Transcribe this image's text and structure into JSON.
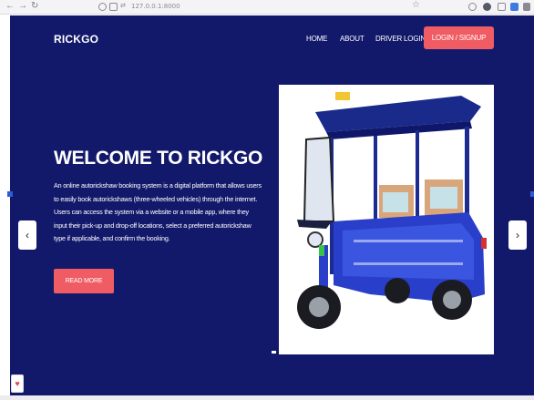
{
  "browser": {
    "url": "127.0.0.1:8000",
    "back_icon": "arrow-left-icon",
    "forward_icon": "arrow-right-icon",
    "reload_icon": "reload-icon"
  },
  "navbar": {
    "brand": "RICKGO",
    "links": [
      {
        "label": "HOME"
      },
      {
        "label": "ABOUT"
      },
      {
        "label": "DRIVER LOGIN"
      }
    ],
    "signup_label": "LOGIN / SIGNUP"
  },
  "hero": {
    "title": "WELCOME TO RICKGO",
    "description": "An online autorickshaw booking system is a digital platform that allows users to easily book autorickshaws (three-wheeled vehicles) through the internet. Users can access the system via a website or a mobile app, where they input their pick-up and drop-off locations, select a preferred autorickshaw type if applicable, and confirm the booking.",
    "read_more_label": "READ MORE",
    "image_subject": "electric-autorickshaw"
  },
  "carousel": {
    "prev_symbol": "‹",
    "next_symbol": "›"
  },
  "colors": {
    "page_background": "#13196a",
    "accent": "#f05c63",
    "text": "#ffffff"
  }
}
